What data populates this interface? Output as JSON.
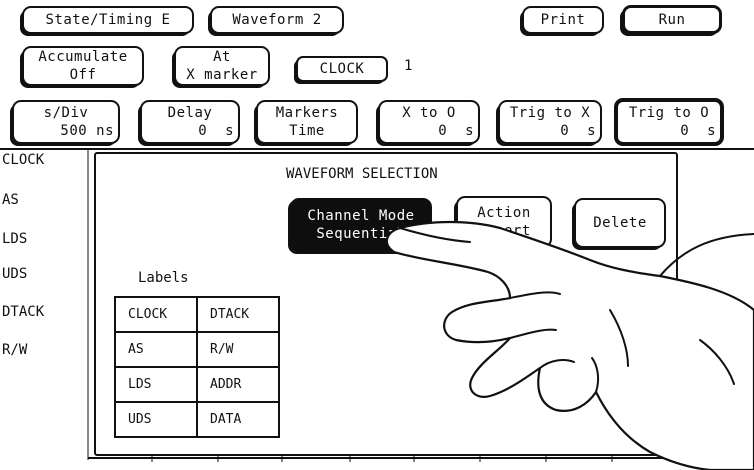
{
  "top_bar": {
    "state_timing": "State/Timing E",
    "waveform": "Waveform 2",
    "print": "Print",
    "run": "Run"
  },
  "second_bar": {
    "accumulate": [
      "Accumulate",
      "Off"
    ],
    "at_marker": [
      "At",
      "X marker"
    ],
    "label_field": "CLOCK",
    "label_index": "1"
  },
  "third_bar": {
    "s_div": [
      "s/Div",
      "500 ns"
    ],
    "delay": [
      "Delay",
      "0  s"
    ],
    "markers": [
      "Markers",
      "Time"
    ],
    "x_to_o": [
      "X to O",
      "0  s"
    ],
    "trig_to_x": [
      "Trig to X",
      "0  s"
    ],
    "trig_to_o": [
      "Trig to O",
      "0  s"
    ]
  },
  "channels": [
    "CLOCK",
    "AS",
    "LDS",
    "UDS",
    "DTACK",
    "R/W"
  ],
  "dialog": {
    "title": "WAVEFORM SELECTION",
    "channel_mode": [
      "Channel Mode",
      "Sequential"
    ],
    "action": [
      "Action",
      "Insert"
    ],
    "delete": "Delete",
    "labels_heading": "Labels",
    "labels_grid": [
      [
        "CLOCK",
        "DTACK"
      ],
      [
        "AS",
        "R/W"
      ],
      [
        "LDS",
        "ADDR"
      ],
      [
        "UDS",
        "DATA"
      ]
    ]
  }
}
